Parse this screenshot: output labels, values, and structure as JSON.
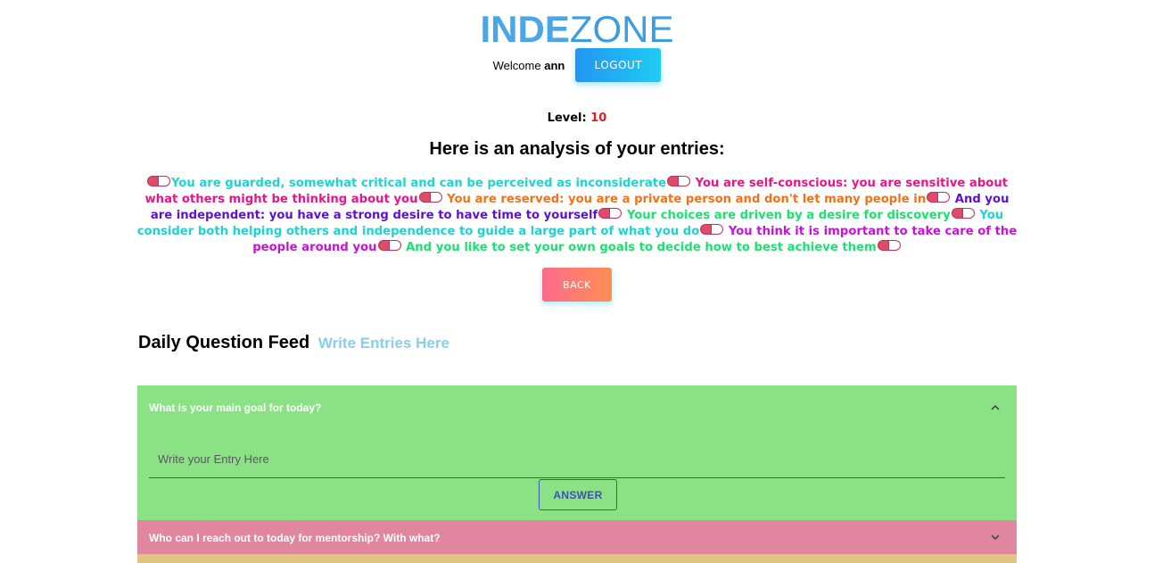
{
  "header": {
    "logo_part1": "INDE",
    "logo_part2": "ZONE",
    "welcome_prefix": "Welcome",
    "username": "ann",
    "logout_label": "LOGOUT"
  },
  "level": {
    "label": "Level:",
    "value": "10"
  },
  "analysis": {
    "title": "Here is an analysis of your entries:",
    "pill_icon": "pill-icon",
    "statements": [
      {
        "text": "You are guarded, somewhat critical and can be perceived as inconsiderate",
        "color": "#1ed3d0"
      },
      {
        "text": " You are self-conscious: you are sensitive about what others might be thinking about you",
        "color": "#e7158a"
      },
      {
        "text": " You are reserved: you are a private person and don't let many people in",
        "color": "#f27219"
      },
      {
        "text": " And you are independent: you have a strong desire to have time to yourself",
        "color": "#5c12d1"
      },
      {
        "text": " Your choices are driven by a desire for discovery",
        "color": "#1de070"
      },
      {
        "text": " You consider both helping others and independence to guide a large part of what you do",
        "color": "#1ed3d0"
      },
      {
        "text": " You think it is important to take care of the people around you",
        "color": "#c712d8"
      },
      {
        "text": " And you like to set your own goals to decide how to best achieve them",
        "color": "#1de070"
      }
    ],
    "back_label": "BACK"
  },
  "feed": {
    "title": "Daily Question Feed",
    "link": "Write Entries Here",
    "items": [
      {
        "question": "What is your main goal for today?",
        "placeholder": "Write your Entry Here",
        "answer_label": "ANSWER",
        "color": "#8ae285",
        "expanded": true
      },
      {
        "question": "Who can I reach out to today for mentorship? With what?",
        "color": "#e0879f",
        "expanded": false
      }
    ]
  }
}
